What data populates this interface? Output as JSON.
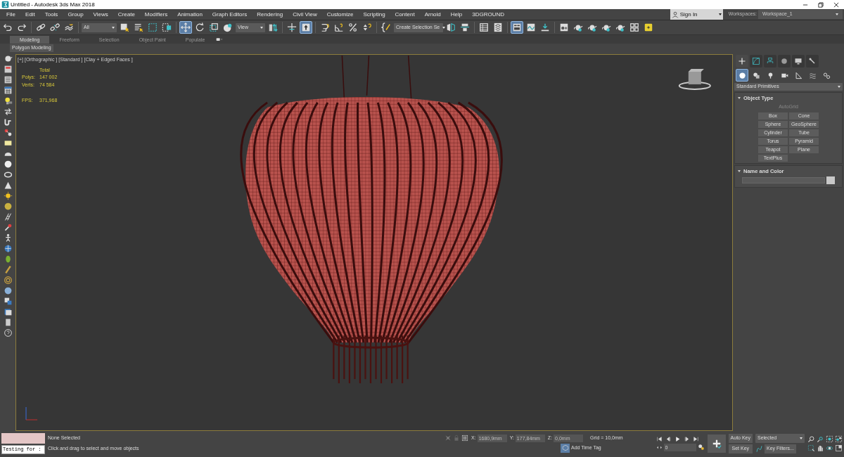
{
  "window": {
    "title": "Untitled - Autodesk 3ds Max 2018"
  },
  "menu": [
    "File",
    "Edit",
    "Tools",
    "Group",
    "Views",
    "Create",
    "Modifiers",
    "Animation",
    "Graph Editors",
    "Rendering",
    "Civil View",
    "Customize",
    "Scripting",
    "Content",
    "Arnold",
    "Help",
    "3DGROUND"
  ],
  "account": {
    "label": "Sign In"
  },
  "workspaces": {
    "label": "Workspaces:",
    "value": "Workspace_1"
  },
  "toolbar": {
    "dropdowns": [
      "All",
      "View",
      "Create Selection Se"
    ],
    "buttons": [
      {
        "selected": false
      },
      {
        "selected": false
      },
      {
        "selected": false
      },
      {
        "selected": false
      },
      {
        "selected": false
      },
      {
        "selected": false
      },
      {
        "selected": false
      },
      {
        "selected": false
      },
      {
        "selected": false
      },
      {
        "selected": true
      },
      {
        "selected": false
      },
      {
        "selected": false
      },
      {
        "selected": false
      },
      {
        "selected": false
      },
      {
        "selected": false
      },
      {
        "selected": true
      },
      {
        "selected": false
      },
      {
        "selected": false
      },
      {
        "selected": false
      },
      {
        "selected": false
      },
      {
        "selected": false
      },
      {
        "selected": false
      },
      {
        "selected": false
      },
      {
        "selected": false
      },
      {
        "selected": false
      },
      {
        "selected": true
      },
      {
        "selected": false
      },
      {
        "selected": false
      },
      {
        "selected": false
      },
      {
        "selected": false
      },
      {
        "selected": false
      },
      {
        "selected": false
      },
      {
        "selected": false
      },
      {
        "selected": false
      },
      {
        "selected": false
      }
    ]
  },
  "ribbon": {
    "tabs": [
      {
        "label": "Modeling",
        "selected": true
      },
      {
        "label": "Freeform",
        "selected": false
      },
      {
        "label": "Selection",
        "selected": false
      },
      {
        "label": "Object Paint",
        "selected": false
      },
      {
        "label": "Populate",
        "selected": false
      }
    ],
    "panel": "Polygon Modeling"
  },
  "viewport": {
    "labels": [
      "[+]",
      "[Orthographic ]",
      "[Standard ]",
      "[Clay + Edged Faces ]"
    ],
    "stats_header": "Total",
    "stats": [
      {
        "label": "Polys:",
        "value": "147 002"
      },
      {
        "label": "Verts:",
        "value": "74 584"
      },
      {
        "label": "FPS:",
        "value": "371,968"
      }
    ]
  },
  "command_panel": {
    "tabs": [
      {
        "selected": true
      },
      {
        "selected": false
      },
      {
        "selected": false
      },
      {
        "selected": false
      },
      {
        "selected": false
      },
      {
        "selected": false
      }
    ],
    "categories": [
      {
        "selected": true
      },
      {
        "selected": false
      },
      {
        "selected": false
      },
      {
        "selected": false
      },
      {
        "selected": false
      },
      {
        "selected": false
      },
      {
        "selected": false
      }
    ],
    "subcategory": "Standard Primitives",
    "rollouts": [
      {
        "title": "Object Type",
        "expanded": true,
        "autogrid": "AutoGrid",
        "buttons": [
          "Box",
          "Cone",
          "Sphere",
          "GeoSphere",
          "Cylinder",
          "Tube",
          "Torus",
          "Pyramid",
          "Teapot",
          "Plane",
          "TextPlus"
        ]
      },
      {
        "title": "Name and Color",
        "expanded": true
      }
    ]
  },
  "status": {
    "listener_input": "Testing for :",
    "selection": "None Selected",
    "prompt": "Click and drag to select and move objects",
    "coords": [
      {
        "label": "X:",
        "value": "1680,9mm"
      },
      {
        "label": "Y:",
        "value": "177,84mm"
      },
      {
        "label": "Z:",
        "value": "0,0mm"
      }
    ],
    "grid": "Grid = 10,0mm",
    "time_tag": "Add Time Tag",
    "frame": "0",
    "auto_key": "Auto Key",
    "set_key": "Set Key",
    "key_mode": "Selected",
    "key_filters": "Key Filters..."
  }
}
